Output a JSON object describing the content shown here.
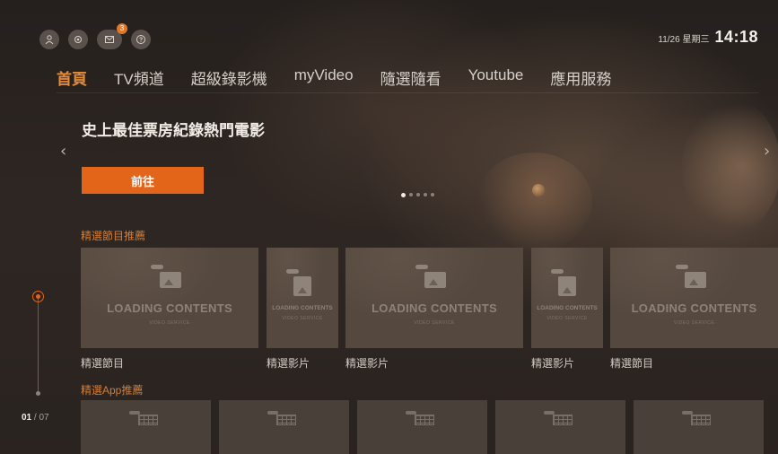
{
  "status": {
    "date": "11/26 星期三",
    "time": "14:18",
    "message_badge": "3"
  },
  "top_icons": [
    "user-icon",
    "settings-icon",
    "message-icon",
    "help-icon"
  ],
  "nav": {
    "tabs": [
      {
        "label": "首頁",
        "active": true
      },
      {
        "label": "TV頻道",
        "active": false
      },
      {
        "label": "超級錄影機",
        "active": false
      },
      {
        "label": "myVideo",
        "active": false
      },
      {
        "label": "隨選隨看",
        "active": false
      },
      {
        "label": "Youtube",
        "active": false
      },
      {
        "label": "應用服務",
        "active": false
      }
    ]
  },
  "hero": {
    "title": "史上最佳票房紀錄熱門電影",
    "button_label": "前往",
    "prev_arrow": "‹",
    "next_arrow": "›",
    "slide_count": 5,
    "active_slide": 0
  },
  "pager": {
    "current": "01",
    "total": "/ 07"
  },
  "sections": {
    "featured": {
      "title": "精選節目推薦",
      "cards": [
        {
          "loading_text": "LOADING CONTENTS",
          "service_text": "VIDEO SERVICE",
          "caption": "精選節目"
        },
        {
          "loading_text": "LOADING CONTENTS",
          "service_text": "VIDEO SERVICE",
          "caption": "精選影片"
        },
        {
          "loading_text": "LOADING CONTENTS",
          "service_text": "VIDEO SERVICE",
          "caption": "精選影片"
        },
        {
          "loading_text": "LOADING CONTENTS",
          "service_text": "VIDEO SERVICE",
          "caption": "精選影片"
        },
        {
          "loading_text": "LOADING CONTENTS",
          "service_text": "VIDEO SERVICE",
          "caption": "精選節目"
        }
      ]
    },
    "apps": {
      "title": "精選App推薦",
      "count": 5
    }
  },
  "colors": {
    "accent": "#e2651a",
    "active_tab": "#e48a39",
    "section_title": "#d07e3a",
    "background": "#2a2320"
  }
}
